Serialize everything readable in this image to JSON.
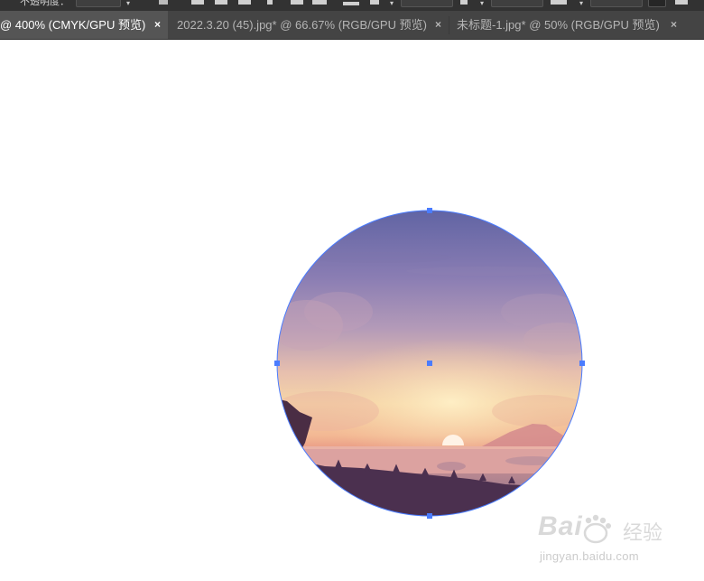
{
  "toolbar": {
    "opacity_label": "不透明度："
  },
  "tabs": [
    {
      "title": "@ 400% (CMYK/GPU 预览)",
      "close": "×",
      "active": true
    },
    {
      "title": "2022.3.20 (45).jpg* @ 66.67% (RGB/GPU 预览)",
      "close": "×",
      "active": false
    },
    {
      "title": "未标题-1.jpg* @ 50% (RGB/GPU 预览)",
      "close": "×",
      "active": false
    }
  ],
  "colors": {
    "toolbar_bg": "#323232",
    "tab_bg": "#444444",
    "active_tab_bg": "#555555",
    "selection": "#4a7cff",
    "sky_top": "#6a6aa6",
    "horizon_glow": "#f7dba6",
    "ground": "#4a2f4d"
  },
  "watermark": {
    "brand": "Bai",
    "suffix": "经验",
    "url": "jingyan.baidu.com"
  }
}
